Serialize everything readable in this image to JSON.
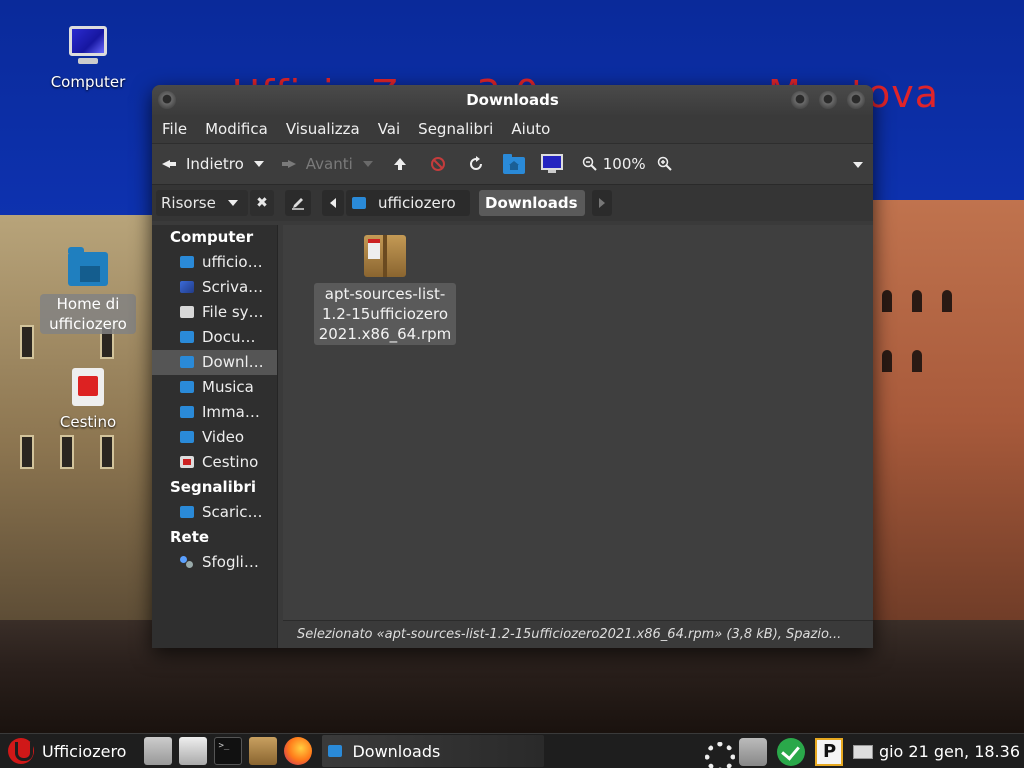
{
  "desktop": {
    "overlay_text": "Ufficio Zero 3.0",
    "overlay_text_right": "Mantova",
    "icons": [
      {
        "label": "Computer"
      },
      {
        "label": "Home di ufficiozero"
      },
      {
        "label": "Cestino"
      }
    ]
  },
  "window": {
    "title": "Downloads",
    "menu": [
      "File",
      "Modifica",
      "Visualizza",
      "Vai",
      "Segnalibri",
      "Aiuto"
    ],
    "toolbar": {
      "back_label": "Indietro",
      "forward_label": "Avanti",
      "zoom": "100%"
    },
    "pathbar": {
      "side_combo": "Risorse",
      "crumbs": [
        "ufficiozero",
        "Downloads"
      ]
    },
    "sidebar": {
      "sections": [
        {
          "heading": "Computer",
          "items": [
            "ufficio…",
            "Scriva…",
            "File sy…",
            "Docu…",
            "Downl…",
            "Musica",
            "Imma…",
            "Video",
            "Cestino"
          ]
        },
        {
          "heading": "Segnalibri",
          "items": [
            "Scaric…"
          ]
        },
        {
          "heading": "Rete",
          "items": [
            "Sfogli…"
          ]
        }
      ],
      "selected": "Downl…"
    },
    "files": [
      {
        "name": "apt-sources-list-1.2-15ufficiozero2021.x86_64.rpm",
        "icon": "package-icon"
      }
    ],
    "status": "Selezionato «apt-sources-list-1.2-15ufficiozero2021.x86_64.rpm» (3,8 kB), Spazio..."
  },
  "taskbar": {
    "start_label": "Ufficiozero",
    "task_label": "Downloads",
    "clock": "gio 21 gen, 18.36"
  },
  "colors": {
    "accent_folder": "#2a8ad8",
    "start_red": "#d01818",
    "window_bg": "#3a3a3a"
  }
}
